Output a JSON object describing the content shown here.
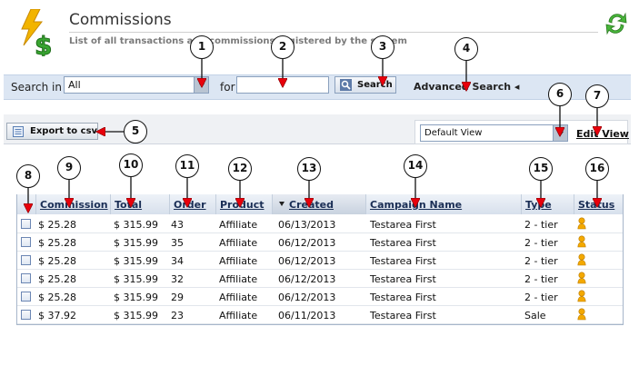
{
  "header": {
    "title": "Commissions",
    "subtitle": "List of all transactions and commissions registered by the system"
  },
  "search": {
    "search_in_label": "Search in",
    "search_in_value": "All",
    "for_label": "for",
    "for_value": "",
    "search_button": "Search",
    "advanced_search": "Advanced Search ◂"
  },
  "toolbar": {
    "export_button": "Export to csv",
    "view_value": "Default View",
    "edit_view": "Edit View"
  },
  "table": {
    "columns": {
      "commission": "Commission",
      "total": "Total",
      "order": "Order",
      "product": "Product",
      "created": "Created",
      "campaign": "Campaign Name",
      "type": "Type",
      "status": "Status"
    },
    "rows": [
      {
        "commission": "$ 25.28",
        "total": "$ 315.99",
        "order": "43",
        "product": "Affiliate",
        "created": "06/13/2013",
        "campaign": "Testarea First",
        "type": "2 - tier"
      },
      {
        "commission": "$ 25.28",
        "total": "$ 315.99",
        "order": "35",
        "product": "Affiliate",
        "created": "06/12/2013",
        "campaign": "Testarea First",
        "type": "2 - tier"
      },
      {
        "commission": "$ 25.28",
        "total": "$ 315.99",
        "order": "34",
        "product": "Affiliate",
        "created": "06/12/2013",
        "campaign": "Testarea First",
        "type": "2 - tier"
      },
      {
        "commission": "$ 25.28",
        "total": "$ 315.99",
        "order": "32",
        "product": "Affiliate",
        "created": "06/12/2013",
        "campaign": "Testarea First",
        "type": "2 - tier"
      },
      {
        "commission": "$ 25.28",
        "total": "$ 315.99",
        "order": "29",
        "product": "Affiliate",
        "created": "06/12/2013",
        "campaign": "Testarea First",
        "type": "2 - tier"
      },
      {
        "commission": "$ 37.92",
        "total": "$ 315.99",
        "order": "23",
        "product": "Affiliate",
        "created": "06/11/2013",
        "campaign": "Testarea First",
        "type": "Sale"
      }
    ]
  },
  "callouts": [
    "1",
    "2",
    "3",
    "4",
    "5",
    "6",
    "7",
    "8",
    "9",
    "10",
    "11",
    "12",
    "13",
    "14",
    "15",
    "16"
  ],
  "colors": {
    "search_bar": "#dce6f3",
    "header_row": "#d7e0ec",
    "callout_arrow": "#e8000b"
  },
  "icons": [
    "dollar-lightning-logo",
    "refresh-icon",
    "search-icon",
    "export-csv-icon",
    "sort-desc-icon",
    "status-pending-icon"
  ]
}
